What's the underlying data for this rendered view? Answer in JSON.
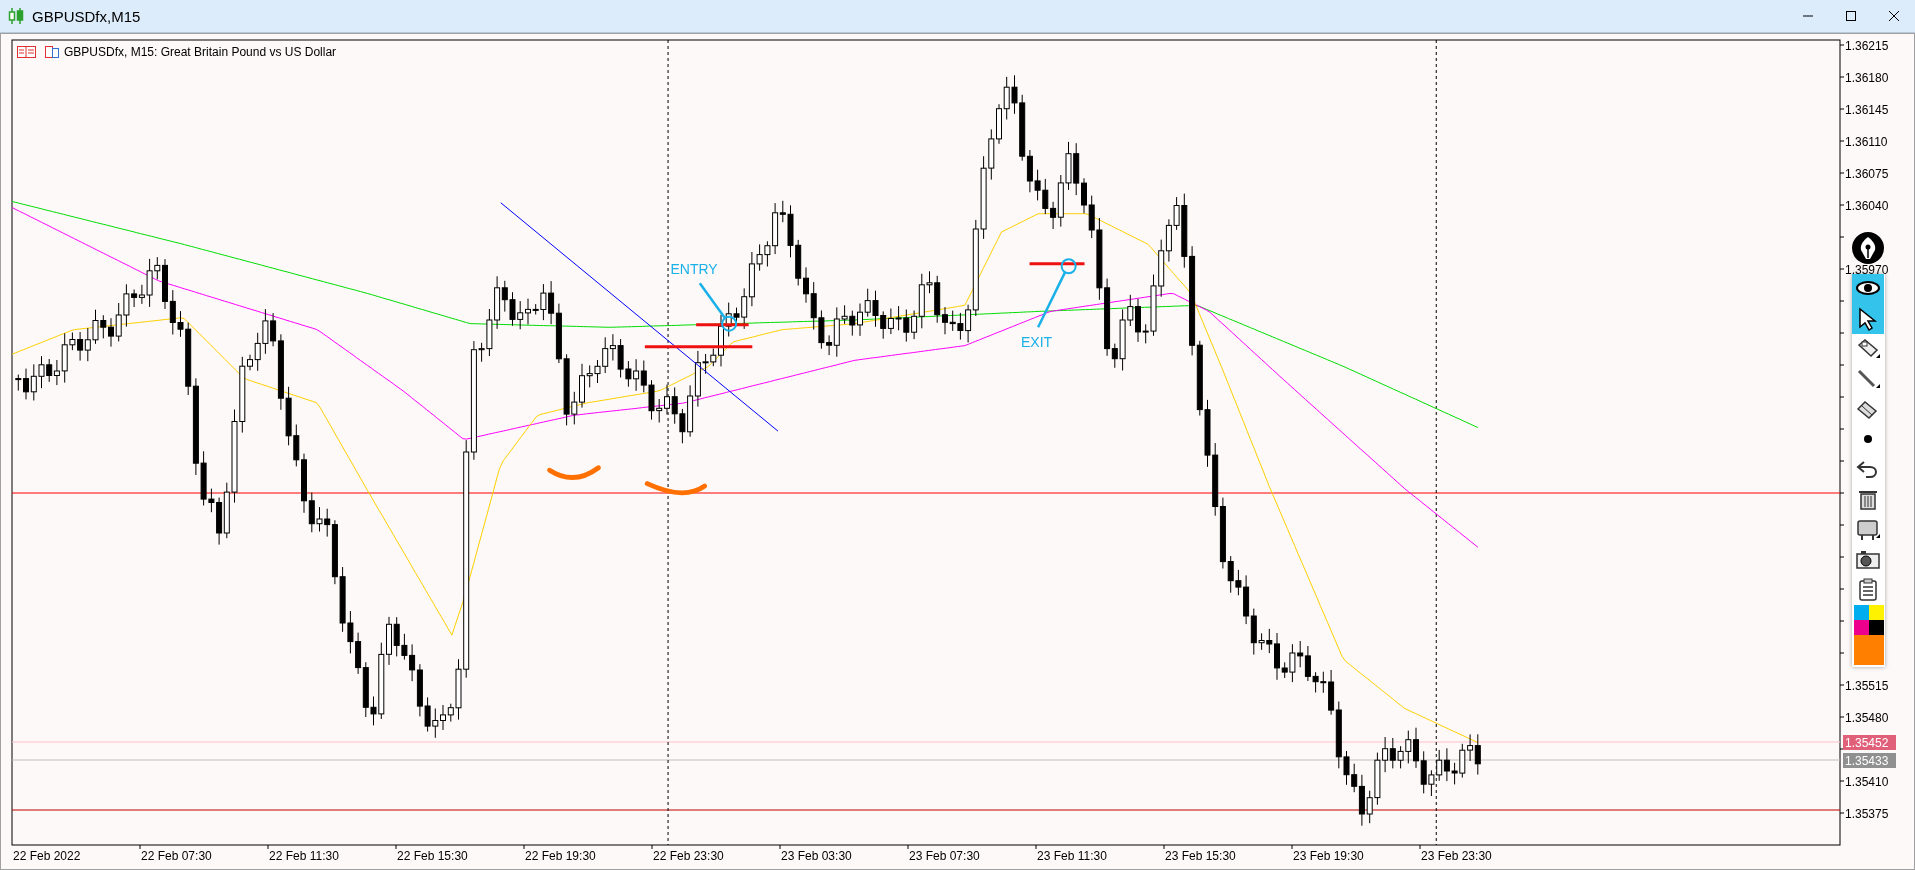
{
  "window": {
    "title": "GBPUSDfx,M15"
  },
  "chart": {
    "header": "GBPUSDfx, M15:  Great Britain Pound vs US Dollar",
    "price_labels": [
      "1.36215",
      "1.36180",
      "1.36145",
      "1.36110",
      "1.36075",
      "1.36040",
      "1.35970",
      "1.35515",
      "1.35480",
      "1.35410",
      "1.35375"
    ],
    "quote_markers": [
      {
        "kind": "bid",
        "label": "1.35452"
      },
      {
        "kind": "ask",
        "label": "1.35433"
      }
    ],
    "time_labels": [
      "22 Feb 2022",
      "22 Feb 07:30",
      "22 Feb 11:30",
      "22 Feb 15:30",
      "22 Feb 19:30",
      "22 Feb 23:30",
      "23 Feb 03:30",
      "23 Feb 07:30",
      "23 Feb 11:30",
      "23 Feb 15:30",
      "23 Feb 19:30",
      "23 Feb 23:30"
    ],
    "annotations": [
      {
        "kind": "entry",
        "text": "ENTRY"
      },
      {
        "kind": "exit",
        "text": "EXIT"
      }
    ]
  },
  "toolbar": {
    "items": [
      {
        "kind": "eye",
        "selected": true
      },
      {
        "kind": "cursor",
        "selected": true
      },
      {
        "kind": "tag",
        "selected": false
      },
      {
        "kind": "line",
        "selected": false
      },
      {
        "kind": "eraser",
        "selected": false
      },
      {
        "kind": "dot",
        "selected": false
      },
      {
        "kind": "undo",
        "selected": false
      },
      {
        "kind": "trash",
        "selected": false
      },
      {
        "kind": "monitor",
        "selected": false
      },
      {
        "kind": "camera",
        "selected": false
      },
      {
        "kind": "clipboard",
        "selected": false
      }
    ],
    "palette": [
      {
        "color": "#00aeef"
      },
      {
        "color": "#fff200"
      },
      {
        "color": "#ec008c"
      },
      {
        "color": "#000000"
      },
      {
        "color": "#ff7f00"
      }
    ]
  }
}
